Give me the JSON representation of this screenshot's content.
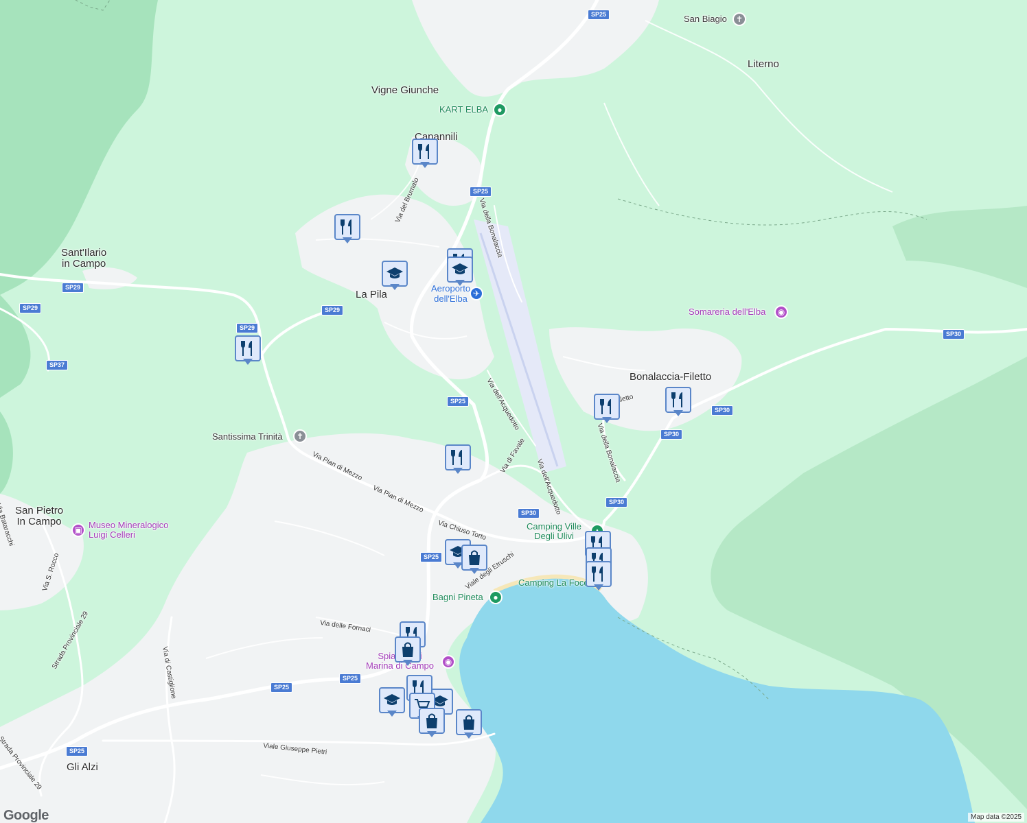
{
  "map": {
    "attribution": "Map data ©2025",
    "logo": "Google",
    "colors": {
      "land": "#cdf5dc",
      "forest": "#a6e3bc",
      "urban": "#f1f3f4",
      "water": "#8fd8ec",
      "road": "#ffffff",
      "airport": "#e5e9f8",
      "marker_fill": "#dfe9fb",
      "marker_border": "#5a86c8",
      "marker_icon": "#0d3f6e"
    }
  },
  "places": [
    {
      "name": "Vigne Giunche"
    },
    {
      "name": "Capannili"
    },
    {
      "name": "San Biagio"
    },
    {
      "name": "Literno"
    },
    {
      "name": "Sant'Ilario\nin Campo"
    },
    {
      "name": "La Pila"
    },
    {
      "name": "Bonalaccia-Filetto"
    },
    {
      "name": "San Pietro\nIn Campo"
    },
    {
      "name": "Gli Alzi"
    },
    {
      "name": "Santissima Trinità"
    }
  ],
  "pois": [
    {
      "name": "KART ELBA",
      "icon": "pin-icon"
    },
    {
      "name": "Aeroporto\ndell'Elba",
      "icon": "airport-icon"
    },
    {
      "name": "Somareria dell'Elba",
      "icon": "camera-icon"
    },
    {
      "name": "Camping Ville\nDegli Ulivi",
      "icon": "camping-icon"
    },
    {
      "name": "Camping La Foce",
      "icon": "camping-icon"
    },
    {
      "name": "Bagni Pineta",
      "icon": "pin-icon"
    },
    {
      "name": "Museo Mineralogico\nLuigi Celleri",
      "icon": "museum-icon"
    },
    {
      "name": "Spiaggia di\nMarina di Campo",
      "icon": "camera-icon"
    }
  ],
  "roads": [
    {
      "name": "Via della Bonalaccia"
    },
    {
      "name": "Via del Brumalo"
    },
    {
      "name": "Via dell'Acquedotto"
    },
    {
      "name": "Via di Favale"
    },
    {
      "name": "Via dell'Acquedotto"
    },
    {
      "name": "Via della Bonalaccia"
    },
    {
      "name": "Via Filetto"
    },
    {
      "name": "Via Pian di Mezzo"
    },
    {
      "name": "Via Pian di Mezzo"
    },
    {
      "name": "Via Chiuso Torto"
    },
    {
      "name": "Viale degli Etruschi"
    },
    {
      "name": "Via delle Fornaci"
    },
    {
      "name": "Via di Castiglione"
    },
    {
      "name": "Strada Provinciale 29"
    },
    {
      "name": "Strada Provinciale 29"
    },
    {
      "name": "Viale Giuseppe Pietri"
    },
    {
      "name": "Via Bataracchi"
    },
    {
      "name": "Via S. Rocco"
    }
  ],
  "shields": [
    "SP25",
    "SP25",
    "SP25",
    "SP25",
    "SP25",
    "SP25",
    "SP29",
    "SP29",
    "SP29",
    "SP29",
    "SP37",
    "SP30",
    "SP30",
    "SP30",
    "SP30",
    "SP30"
  ],
  "markers": [
    {
      "icon": "restaurant-icon"
    },
    {
      "icon": "restaurant-icon"
    },
    {
      "icon": "restaurant-icon"
    },
    {
      "icon": "school-icon"
    },
    {
      "icon": "school-icon"
    },
    {
      "icon": "restaurant-icon"
    },
    {
      "icon": "restaurant-icon"
    },
    {
      "icon": "restaurant-icon"
    },
    {
      "icon": "school-icon"
    },
    {
      "icon": "shopping-bag-icon"
    },
    {
      "icon": "restaurant-icon"
    },
    {
      "icon": "restaurant-icon"
    },
    {
      "icon": "restaurant-icon"
    },
    {
      "icon": "restaurant-icon"
    },
    {
      "icon": "shopping-bag-icon"
    },
    {
      "icon": "school-icon"
    },
    {
      "icon": "shopping-cart-icon"
    },
    {
      "icon": "shopping-bag-icon"
    },
    {
      "icon": "shopping-bag-icon"
    }
  ]
}
